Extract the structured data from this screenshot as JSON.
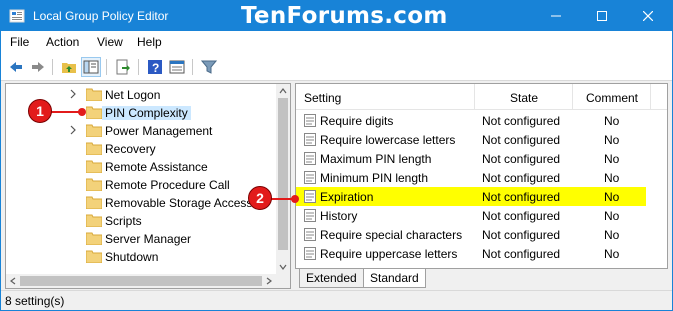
{
  "window": {
    "title": "Local Group Policy Editor",
    "watermark": "TenForums.com",
    "accent": "#1883d7"
  },
  "menu": [
    "File",
    "Action",
    "View",
    "Help"
  ],
  "toolbar": {
    "icons": [
      "back-arrow-icon",
      "forward-arrow-icon",
      "up-folder-icon",
      "show-hide-tree-icon",
      "export-list-icon",
      "help-icon",
      "properties-icon",
      "filter-icon"
    ]
  },
  "tree": {
    "items": [
      {
        "label": "Net Logon",
        "expandable": true,
        "selected": false
      },
      {
        "label": "PIN Complexity",
        "expandable": false,
        "selected": true
      },
      {
        "label": "Power Management",
        "expandable": true,
        "selected": false
      },
      {
        "label": "Recovery",
        "expandable": false,
        "selected": false
      },
      {
        "label": "Remote Assistance",
        "expandable": false,
        "selected": false
      },
      {
        "label": "Remote Procedure Call",
        "expandable": false,
        "selected": false
      },
      {
        "label": "Removable Storage Access",
        "expandable": false,
        "selected": false
      },
      {
        "label": "Scripts",
        "expandable": false,
        "selected": false
      },
      {
        "label": "Server Manager",
        "expandable": false,
        "selected": false
      },
      {
        "label": "Shutdown",
        "expandable": false,
        "selected": false
      }
    ]
  },
  "list": {
    "columns": [
      "Setting",
      "State",
      "Comment"
    ],
    "rows": [
      {
        "setting": "Require digits",
        "state": "Not configured",
        "comment": "No",
        "highlight": false
      },
      {
        "setting": "Require lowercase letters",
        "state": "Not configured",
        "comment": "No",
        "highlight": false
      },
      {
        "setting": "Maximum PIN length",
        "state": "Not configured",
        "comment": "No",
        "highlight": false
      },
      {
        "setting": "Minimum PIN length",
        "state": "Not configured",
        "comment": "No",
        "highlight": false
      },
      {
        "setting": "Expiration",
        "state": "Not configured",
        "comment": "No",
        "highlight": true
      },
      {
        "setting": "History",
        "state": "Not configured",
        "comment": "No",
        "highlight": false
      },
      {
        "setting": "Require special characters",
        "state": "Not configured",
        "comment": "No",
        "highlight": false
      },
      {
        "setting": "Require uppercase letters",
        "state": "Not configured",
        "comment": "No",
        "highlight": false
      }
    ],
    "highlight_color": "#ffff00"
  },
  "tabs": [
    "Extended",
    "Standard"
  ],
  "active_tab": "Standard",
  "status": "8 setting(s)",
  "callouts": [
    "1",
    "2"
  ],
  "callout_color": "#e21b1b"
}
